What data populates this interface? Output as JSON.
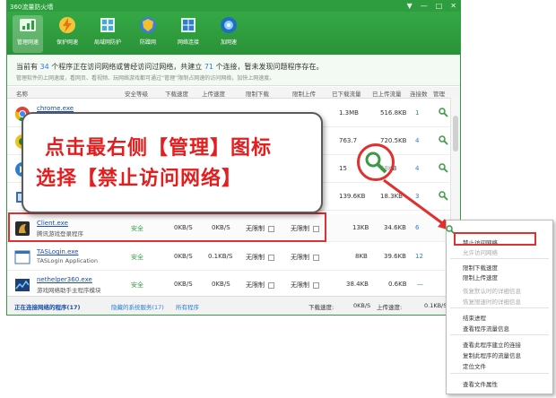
{
  "window": {
    "title": "360流量防火墙",
    "controls": [
      "▼",
      "—",
      "□",
      "✕"
    ]
  },
  "toolbar": {
    "items": [
      {
        "label": "管理网速",
        "icon": "speed-icon",
        "active": true
      },
      {
        "label": "保护网速",
        "icon": "lightning-icon",
        "active": false
      },
      {
        "label": "局域网防护",
        "icon": "lan-icon",
        "active": false
      },
      {
        "label": "防蹭网",
        "icon": "shield-icon",
        "active": false
      },
      {
        "label": "网络连接",
        "icon": "network-icon",
        "active": false
      },
      {
        "label": "加网速",
        "icon": "rocket-icon",
        "active": false
      }
    ]
  },
  "summary": {
    "line1_prefix": "当前有",
    "process_count": "34",
    "line1_mid": "个程序正在访问网络或曾经访问过网络，共建立",
    "connection_count": "71",
    "line1_suffix": "个连接，暂未发现问题程序存在。",
    "line2": "管理软件的上网速度，看网页、看视频、玩网络游戏都可通过“管理”限制占网速的访问网络，加快上网速度。"
  },
  "columns": [
    "名称",
    "安全等级",
    "下载速度",
    "上传速度",
    "限制下载",
    "限制上传",
    "已下载流量",
    "已上传流量",
    "连接数",
    "管理"
  ],
  "rows": [
    {
      "name": "chrome.exe",
      "desc": "",
      "safety": "",
      "down": "",
      "up": "",
      "limit_down": "",
      "limit_up": "",
      "downloaded": "1.3MB",
      "uploaded": "516.8KB",
      "conns": "1",
      "icon": "chrome-icon"
    },
    {
      "name": "",
      "desc": "",
      "safety": "",
      "down": "",
      "up": "",
      "limit_down": "",
      "limit_up": "",
      "downloaded": "763.7",
      "uploaded": "720.5KB",
      "conns": "4",
      "icon": "app-icon"
    },
    {
      "name": "",
      "desc": "",
      "safety": "",
      "down": "",
      "up": "",
      "limit_down": "",
      "limit_up": "",
      "downloaded": "15",
      "uploaded": "58KB",
      "conns": "4",
      "icon": "app-icon"
    },
    {
      "name": "",
      "desc": "",
      "safety": "",
      "down": "",
      "up": "",
      "limit_down": "",
      "limit_up": "",
      "downloaded": "139.6KB",
      "uploaded": "18.3KB",
      "conns": "3",
      "icon": "app-icon"
    },
    {
      "name": "Client.exe",
      "desc": "腾讯游戏登录程序",
      "safety": "安全",
      "down": "0KB/S",
      "up": "0KB/S",
      "limit_down": "无限制",
      "limit_up": "无限制",
      "downloaded": "13KB",
      "uploaded": "34.6KB",
      "conns": "6",
      "icon": "client-icon"
    },
    {
      "name": "TASLogin.exe",
      "desc": "TASLogin Application",
      "safety": "安全",
      "down": "0KB/S",
      "up": "0.1KB/S",
      "limit_down": "无限制",
      "limit_up": "无限制",
      "downloaded": "8KB",
      "uploaded": "39.6KB",
      "conns": "12",
      "icon": "taslogin-icon"
    },
    {
      "name": "nethelper360.exe",
      "desc": "游戏网络助手主程序模块",
      "safety": "安全",
      "down": "0KB/S",
      "up": "0KB/S",
      "limit_down": "无限制",
      "limit_up": "无限制",
      "downloaded": "38.4KB",
      "uploaded": "0.6KB",
      "conns": "—",
      "icon": "nethelper-icon"
    }
  ],
  "status": {
    "tab_active": "正在连接网络的程序(17)",
    "tab_hidden": "隐藏的系统服务(17)",
    "tab_all": "所有程序",
    "down_label": "下载速度:",
    "down_value": "0KB/S",
    "up_label": "上传速度:",
    "up_value": "0.1KB/S"
  },
  "callout": {
    "line1": "点击最右侧【管理】图标",
    "line2": "选择【禁止访问网络】"
  },
  "context_menu": {
    "items": [
      {
        "label": "禁止访问网络",
        "disabled": false
      },
      {
        "label": "允许访问网络",
        "disabled": true
      },
      {
        "label": "限制下载速度",
        "disabled": false
      },
      {
        "label": "限制上传速度",
        "disabled": false
      },
      {
        "label": "恢复默认时的详细信息",
        "disabled": true
      },
      {
        "label": "恢复限速时的详细信息",
        "disabled": true
      },
      {
        "label": "结束进程",
        "disabled": false
      },
      {
        "label": "查看程序流量信息",
        "disabled": false
      },
      {
        "label": "查看此程序建立的连接",
        "disabled": false
      },
      {
        "label": "复制此程序的流量信息",
        "disabled": false
      },
      {
        "label": "定位文件",
        "disabled": false
      },
      {
        "label": "查看文件属性",
        "disabled": false
      }
    ]
  },
  "colors": {
    "brand_green": "#2e9d40",
    "highlight_red": "#e03030",
    "link_blue": "#1a4fa8"
  }
}
